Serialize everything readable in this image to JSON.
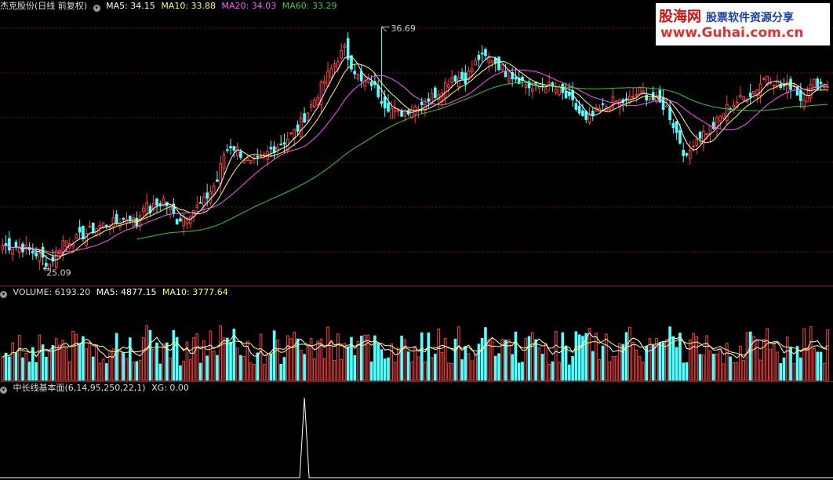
{
  "stock": {
    "name_label": "杰克股份(日线 前复权)",
    "ma5_label": "MA5: 34.15",
    "ma10_label": "MA10: 33.88",
    "ma20_label": "MA20: 34.03",
    "ma60_label": "MA60: 33.29",
    "high_marker": "36.69",
    "low_marker": "25.09"
  },
  "volume": {
    "volume_label": "VOLUME: 6193.20",
    "ma5_label": "MA5: 4877.15",
    "ma10_label": "MA10: 3777.64"
  },
  "indicator": {
    "name_label": "中长线基本面(6,14,95,250,22,1)",
    "xg_label": "XG: 0.00"
  },
  "watermark": {
    "brand": "股海网",
    "tagline": "股票软件资源分享",
    "url": "www.Guhai.com.cn"
  },
  "colors": {
    "up": "#ff4040",
    "down": "#54ffff",
    "ma5": "#ffffff",
    "ma10": "#ffff55",
    "ma20": "#ff55ff",
    "ma60": "#33cc33",
    "grid": "#7a0e0e",
    "background": "#000000"
  },
  "chart_data": [
    {
      "type": "candlestick",
      "title": "杰克股份(日线 前复权)",
      "ylim": [
        24.5,
        37.3
      ],
      "markers": {
        "high": 36.69,
        "low": 25.09
      },
      "series": [
        {
          "name": "MA5",
          "last": 34.15
        },
        {
          "name": "MA10",
          "last": 33.88
        },
        {
          "name": "MA20",
          "last": 34.03
        },
        {
          "name": "MA60",
          "last": 33.29
        }
      ],
      "close_path": [
        [
          0,
          26.2
        ],
        [
          6,
          26.1
        ],
        [
          10,
          25.8
        ],
        [
          14,
          25.3
        ],
        [
          18,
          26.4
        ],
        [
          22,
          26.5
        ],
        [
          26,
          26.9
        ],
        [
          30,
          27.2
        ],
        [
          34,
          27.3
        ],
        [
          38,
          27.6
        ],
        [
          40,
          27.2
        ],
        [
          42,
          28.2
        ],
        [
          44,
          27.9
        ],
        [
          48,
          28.4
        ],
        [
          52,
          27.4
        ],
        [
          56,
          27.8
        ],
        [
          60,
          28.3
        ],
        [
          64,
          29.3
        ],
        [
          66,
          30.6
        ],
        [
          68,
          31.0
        ],
        [
          70,
          30.8
        ],
        [
          72,
          30.4
        ],
        [
          74,
          30.1
        ],
        [
          77,
          30.3
        ],
        [
          80,
          30.8
        ],
        [
          84,
          31.2
        ],
        [
          88,
          31.8
        ],
        [
          92,
          32.9
        ],
        [
          96,
          34.1
        ],
        [
          100,
          35.2
        ],
        [
          102,
          35.6
        ],
        [
          104,
          34.9
        ],
        [
          107,
          34.0
        ],
        [
          110,
          34.0
        ],
        [
          114,
          33.0
        ],
        [
          118,
          32.5
        ],
        [
          122,
          32.8
        ],
        [
          126,
          33.1
        ],
        [
          130,
          33.6
        ],
        [
          134,
          34.3
        ],
        [
          138,
          34.2
        ],
        [
          142,
          35.2
        ],
        [
          146,
          35.2
        ],
        [
          150,
          34.5
        ],
        [
          154,
          34.2
        ],
        [
          158,
          33.7
        ],
        [
          162,
          33.9
        ],
        [
          166,
          33.6
        ],
        [
          170,
          33.0
        ],
        [
          174,
          32.1
        ],
        [
          178,
          32.7
        ],
        [
          182,
          33.1
        ],
        [
          186,
          33.1
        ],
        [
          190,
          33.6
        ],
        [
          194,
          33.2
        ],
        [
          198,
          32.8
        ],
        [
          202,
          31.2
        ],
        [
          204,
          30.3
        ],
        [
          206,
          31.2
        ],
        [
          208,
          31.5
        ],
        [
          212,
          31.9
        ],
        [
          216,
          32.8
        ],
        [
          220,
          33.2
        ],
        [
          224,
          33.6
        ],
        [
          228,
          34.4
        ],
        [
          232,
          33.8
        ],
        [
          236,
          33.9
        ],
        [
          238,
          33.2
        ],
        [
          242,
          34.0
        ],
        [
          246,
          33.9
        ]
      ]
    },
    {
      "type": "bar",
      "title": "VOLUME",
      "series": [
        {
          "name": "VOLUME",
          "last": 6193.2
        },
        {
          "name": "MA5",
          "last": 4877.15
        },
        {
          "name": "MA10",
          "last": 3777.64
        }
      ],
      "ylim": [
        0,
        10000
      ]
    },
    {
      "type": "line",
      "title": "中长线基本面(6,14,95,250,22,1)",
      "series": [
        {
          "name": "XG",
          "last": 0.0,
          "signal_at_bar": 90
        }
      ]
    }
  ]
}
